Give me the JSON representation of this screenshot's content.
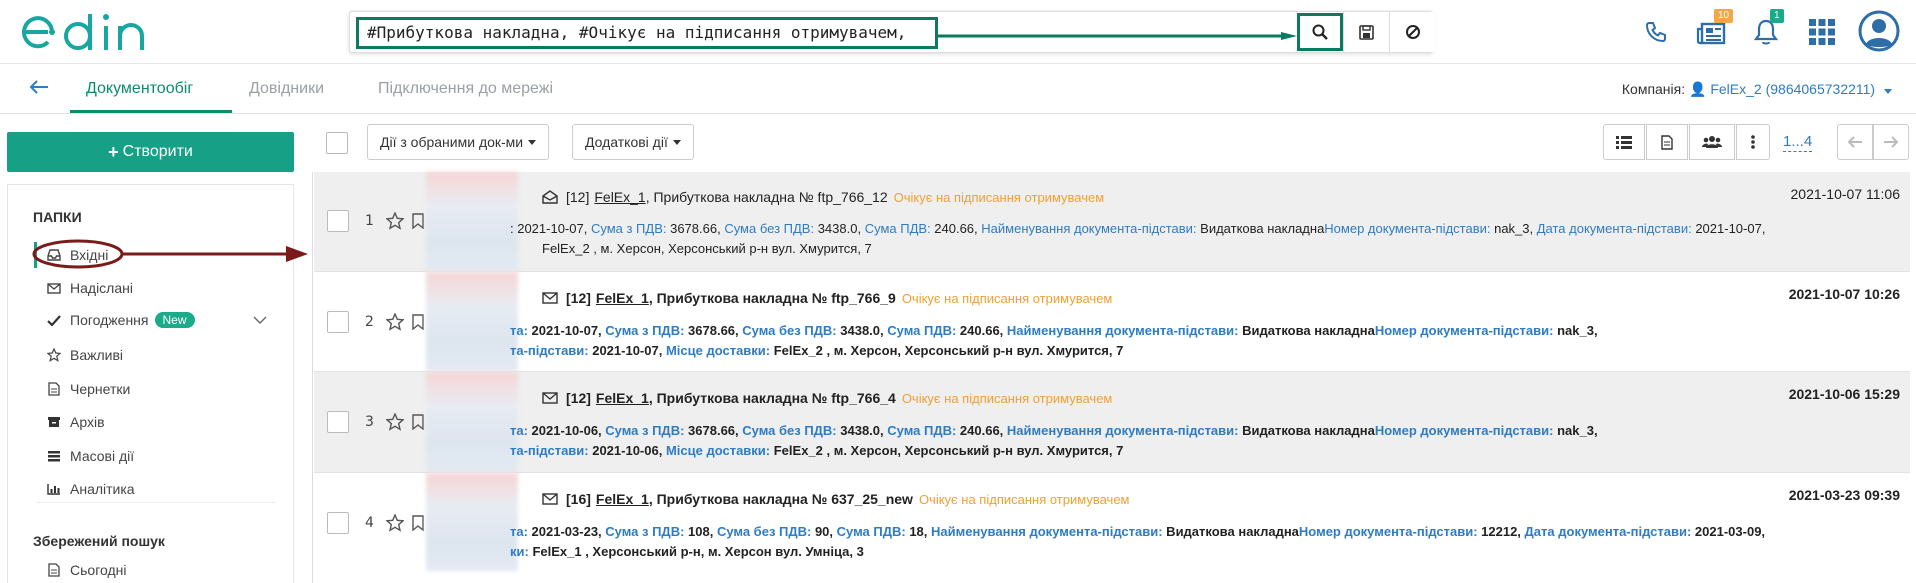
{
  "header": {
    "logo_text": "edin",
    "search": {
      "query": "#Прибуткова накладна, #Очікує на підписання отримувачем,",
      "search_icon": "search-icon",
      "save_icon": "save-icon",
      "clear_icon": "clear-icon"
    },
    "icons": [
      "phone-icon",
      "news-icon",
      "bell-icon",
      "apps-grid-icon",
      "user-avatar-icon"
    ],
    "news_badge": "10",
    "bell_badge": "1"
  },
  "navbar": {
    "tabs": [
      {
        "label": "Документообіг",
        "active": true
      },
      {
        "label": "Довідники",
        "active": false
      },
      {
        "label": "Підключення до мережі",
        "active": false
      }
    ],
    "company_label": "Компанія:",
    "company_value": "FelEx_2 (9864065732211)"
  },
  "sidebar": {
    "create_label": "Створити",
    "folders_heading": "ПАПКИ",
    "items": [
      {
        "label": "Вхідні",
        "icon": "inbox-icon"
      },
      {
        "label": "Надіслані",
        "icon": "envelope-icon"
      },
      {
        "label": "Погодження",
        "icon": "check-icon",
        "badge": "New"
      },
      {
        "label": "Важливі",
        "icon": "star-icon"
      },
      {
        "label": "Чернетки",
        "icon": "draft-icon"
      },
      {
        "label": "Архів",
        "icon": "archive-icon"
      },
      {
        "label": "Масові дії",
        "icon": "bulk-icon"
      },
      {
        "label": "Аналітика",
        "icon": "analytics-icon"
      }
    ],
    "saved_heading": "Збережений пошук",
    "saved_items": [
      {
        "label": "Сьогодні",
        "icon": "document-icon"
      }
    ]
  },
  "toolbar": {
    "bulk_actions": "Дії з обраними док-ми",
    "extra_actions": "Додаткові дії",
    "pager": "1...4"
  },
  "documents": [
    {
      "num": "1",
      "count": "[12]",
      "sender": "FelEx_1",
      "title": ", Прибуткова накладна № ftp_766_12",
      "status": "Очікує на підписання отримувачем",
      "date": "2021-10-07 11:06",
      "line1": [
        {
          "k": "",
          "v": ": 2021-10-07, "
        },
        {
          "k": "Сума з ПДВ:",
          "v": " 3678.66, "
        },
        {
          "k": "Сума без ПДВ:",
          "v": " 3438.0, "
        },
        {
          "k": "Сума ПДВ:",
          "v": " 240.66, "
        },
        {
          "k": "Найменування документа-підстави:",
          "v": " Видаткова накладна"
        },
        {
          "k": "Номер документа-підстави:",
          "v": " nak_3, "
        },
        {
          "k": "Дата документа-підстави:",
          "v": " 2021-10-07,"
        }
      ],
      "line2": [
        {
          "k": "",
          "v": "FelEx_2 , м. Херсон, Херсонський р-н вул. Хмурится, 7"
        }
      ]
    },
    {
      "num": "2",
      "count": "[12]",
      "sender": "FelEx_1",
      "title": ", Прибуткова накладна № ftp_766_9",
      "status": "Очікує на підписання отримувачем",
      "date": "2021-10-07 10:26",
      "line1": [
        {
          "k": "та:",
          "v": " 2021-10-07, "
        },
        {
          "k": "Сума з ПДВ:",
          "v": " 3678.66, "
        },
        {
          "k": "Сума без ПДВ:",
          "v": " 3438.0, "
        },
        {
          "k": "Сума ПДВ:",
          "v": " 240.66, "
        },
        {
          "k": "Найменування документа-підстави:",
          "v": " Видаткова накладна"
        },
        {
          "k": "Номер документа-підстави:",
          "v": " nak_3,"
        }
      ],
      "line2": [
        {
          "k": "та-підстави:",
          "v": " 2021-10-07, "
        },
        {
          "k": "Місце доставки:",
          "v": " FelEx_2 , м. Херсон, Херсонський р-н вул. Хмурится, 7"
        }
      ]
    },
    {
      "num": "3",
      "count": "[12]",
      "sender": "FelEx_1",
      "title": ", Прибуткова накладна № ftp_766_4",
      "status": "Очікує на підписання отримувачем",
      "date": "2021-10-06 15:29",
      "line1": [
        {
          "k": "та:",
          "v": " 2021-10-06, "
        },
        {
          "k": "Сума з ПДВ:",
          "v": " 3678.66, "
        },
        {
          "k": "Сума без ПДВ:",
          "v": " 3438.0, "
        },
        {
          "k": "Сума ПДВ:",
          "v": " 240.66, "
        },
        {
          "k": "Найменування документа-підстави:",
          "v": " Видаткова накладна"
        },
        {
          "k": "Номер документа-підстави:",
          "v": " nak_3,"
        }
      ],
      "line2": [
        {
          "k": "та-підстави:",
          "v": " 2021-10-06, "
        },
        {
          "k": "Місце доставки:",
          "v": " FelEx_2 , м. Херсон, Херсонський р-н вул. Хмурится, 7"
        }
      ]
    },
    {
      "num": "4",
      "count": "[16]",
      "sender": "FelEx_1",
      "title": ", Прибуткова накладна № 637_25_new",
      "status": "Очікує на підписання отримувачем",
      "date": "2021-03-23 09:39",
      "line1": [
        {
          "k": "та:",
          "v": " 2021-03-23, "
        },
        {
          "k": "Сума з ПДВ:",
          "v": " 108, "
        },
        {
          "k": "Сума без ПДВ:",
          "v": " 90, "
        },
        {
          "k": "Сума ПДВ:",
          "v": " 18, "
        },
        {
          "k": "Найменування документа-підстави:",
          "v": " Видаткова накладна"
        },
        {
          "k": "Номер документа-підстави:",
          "v": " 12212, "
        },
        {
          "k": "Дата документа-підстави:",
          "v": " 2021-03-09,"
        }
      ],
      "line2": [
        {
          "k": "ки:",
          "v": " FelEx_1 , Херсонський р-н, м. Херсон вул. Умніца, 3"
        }
      ]
    }
  ],
  "colors": {
    "brand": "#16a085",
    "link": "#2d7cc4",
    "status": "#f0a032",
    "annotation_green": "#0b7a5e",
    "annotation_red": "#7a1a1a"
  }
}
